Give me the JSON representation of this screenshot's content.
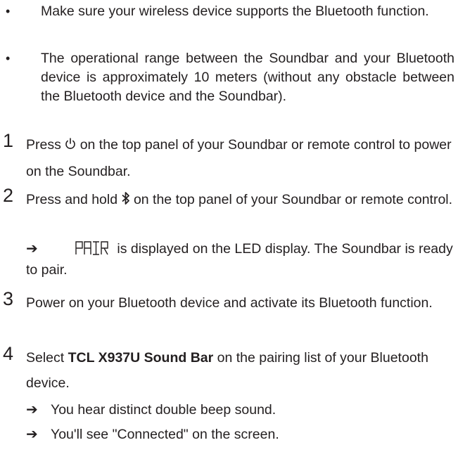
{
  "bullets": [
    {
      "text": "Make sure your wireless device supports the Bluetooth function."
    },
    {
      "text": "The operational range between the Soundbar and your Bluetooth device is approximately 10 meters (without any obstacle between the Bluetooth device and the Soundbar)."
    }
  ],
  "steps": [
    {
      "num": "1",
      "before": "Press",
      "after": "on the top panel of your Soundbar or remote control to power on the Soundbar.",
      "icon": "power-icon"
    },
    {
      "num": "2",
      "before": "Press and hold",
      "after": "on the top panel of your Soundbar or remote control.",
      "icon": "bluetooth-icon",
      "sub": {
        "display_text": "PAIR",
        "text": "is displayed on the LED display. The Soundbar is ready to pair."
      }
    },
    {
      "num": "3",
      "text": "Power on your Bluetooth device and activate its Bluetooth function."
    },
    {
      "num": "4",
      "before": "Select",
      "bold": "TCL X937U Sound Bar",
      "after": "on the pairing list of your Bluetooth device.",
      "subs": [
        "You hear distinct double beep sound.",
        "You'll see \"Connected\" on the screen."
      ]
    }
  ],
  "colors": {
    "text": "#231f20",
    "background": "#ffffff"
  }
}
